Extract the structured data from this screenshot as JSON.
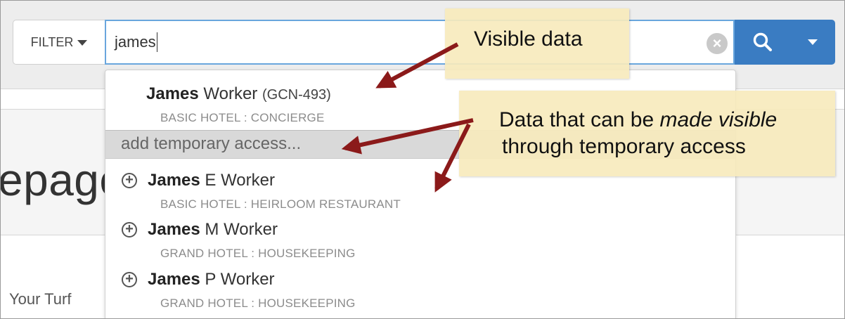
{
  "page": {
    "hero_title": "epage",
    "section_label": "Your Turf"
  },
  "search": {
    "filter_label": "FILTER",
    "query": "james",
    "clear_icon": "clear-circle-icon",
    "search_icon": "magnifier-icon",
    "dropdown_icon": "caret-down-icon"
  },
  "results": {
    "visible": {
      "first": "James",
      "last": " Worker",
      "code": "(GCN-493)",
      "subtitle": "BASIC HOTEL : CONCIERGE"
    },
    "add_temporary_access": "add temporary access...",
    "hidden": [
      {
        "first": "James",
        "last": " E Worker",
        "subtitle": "BASIC HOTEL : HEIRLOOM RESTAURANT"
      },
      {
        "first": "James",
        "last": " M Worker",
        "subtitle": "GRAND HOTEL : HOUSEKEEPING"
      },
      {
        "first": "James",
        "last": " P Worker",
        "subtitle": "GRAND HOTEL : HOUSEKEEPING"
      }
    ]
  },
  "callouts": {
    "visible_data": "Visible data",
    "hidden_data_line1_prefix": "Data that can be ",
    "hidden_data_line1_emphasis": "made visible",
    "hidden_data_line2": "through temporary access"
  },
  "colors": {
    "accent_blue": "#3a7cc2",
    "callout_fill": "#f8ebbd",
    "arrow_red": "#8b1a1a"
  }
}
